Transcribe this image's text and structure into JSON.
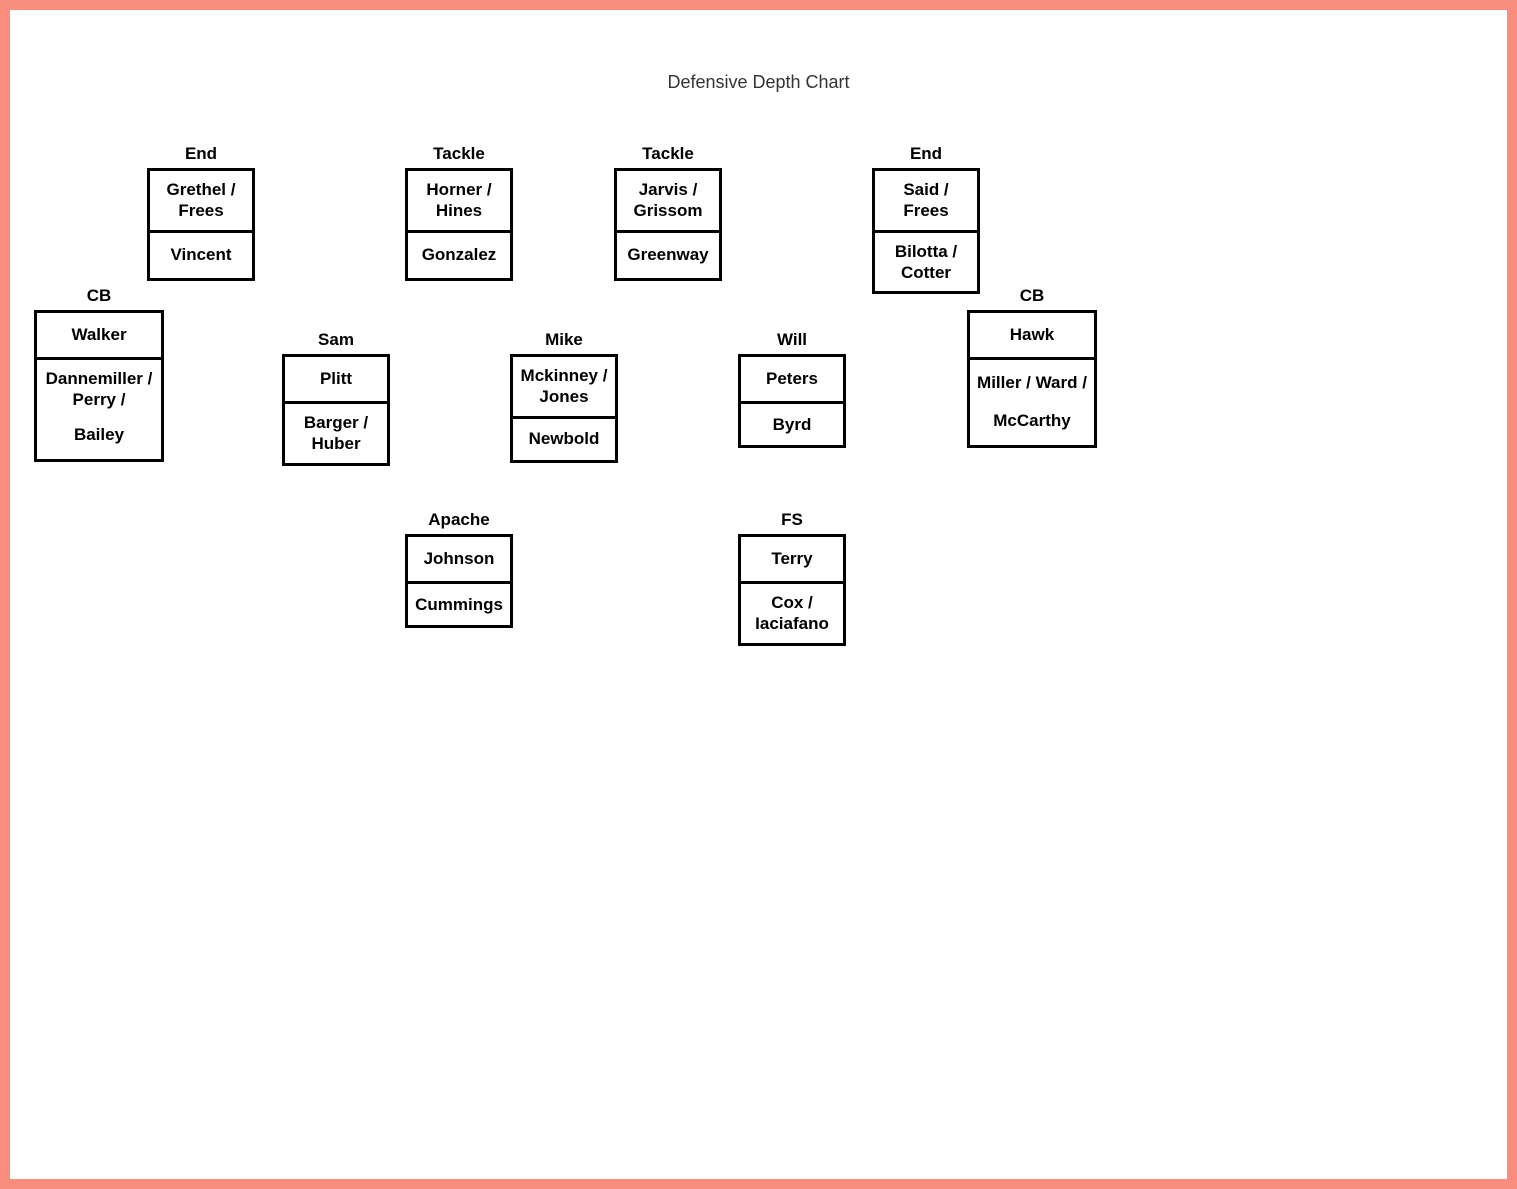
{
  "title": "Defensive Depth Chart",
  "positions": {
    "dl_end_left": {
      "label": "End",
      "slot1": "Grethel / Frees",
      "slot2": "Vincent"
    },
    "dl_tackle_left": {
      "label": "Tackle",
      "slot1": "Horner / Hines",
      "slot2": "Gonzalez"
    },
    "dl_tackle_right": {
      "label": "Tackle",
      "slot1": "Jarvis / Grissom",
      "slot2": "Greenway"
    },
    "dl_end_right": {
      "label": "End",
      "slot1": "Said / Frees",
      "slot2": "Bilotta / Cotter"
    },
    "cb_left": {
      "label": "CB",
      "slot1": "Walker",
      "slot2": "Dannemiller / Perry /",
      "slot3": "Bailey"
    },
    "sam": {
      "label": "Sam",
      "slot1": "Plitt",
      "slot2": "Barger / Huber"
    },
    "mike": {
      "label": "Mike",
      "slot1": "Mckinney / Jones",
      "slot2": "Newbold"
    },
    "will": {
      "label": "Will",
      "slot1": "Peters",
      "slot2": "Byrd"
    },
    "cb_right": {
      "label": "CB",
      "slot1": "Hawk",
      "slot2": "Miller / Ward /",
      "slot3": "McCarthy"
    },
    "apache": {
      "label": "Apache",
      "slot1": "Johnson",
      "slot2": "Cummings"
    },
    "fs": {
      "label": "FS",
      "slot1": "Terry",
      "slot2": "Cox / Iaciafano"
    }
  }
}
